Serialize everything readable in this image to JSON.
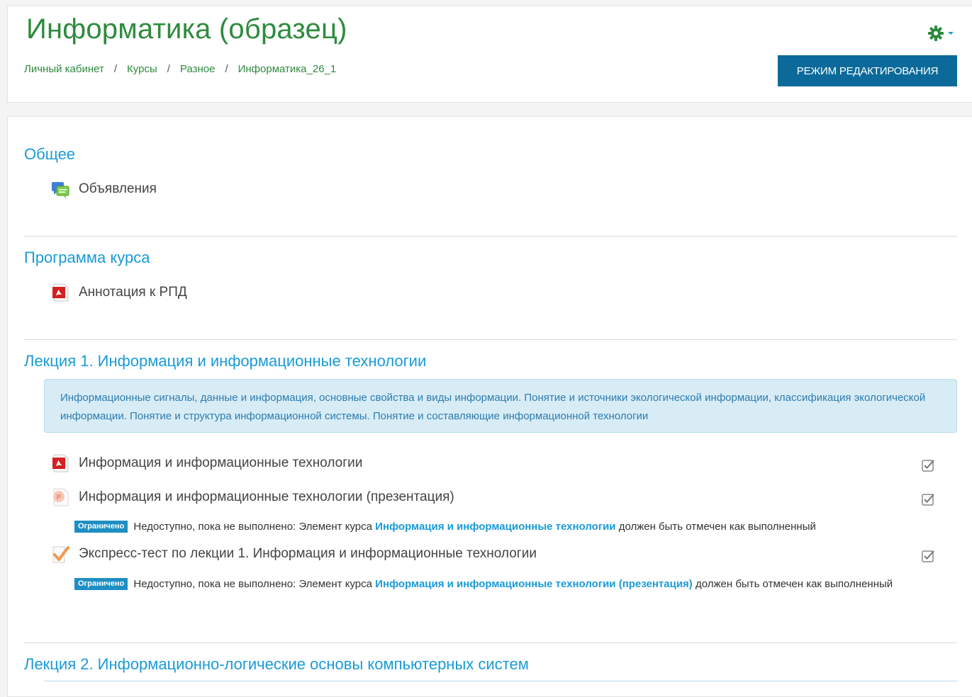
{
  "header": {
    "title": "Информатика (образец)",
    "breadcrumb": [
      "Личный кабинет",
      "Курсы",
      "Разное",
      "Информатика_26_1"
    ],
    "separator": "/",
    "edit_mode_button": "РЕЖИМ РЕДАКТИРОВАНИЯ",
    "settings_icon": "gear-icon",
    "accent_color": "#2e8b3e",
    "button_color": "#0b6a9a"
  },
  "sections": [
    {
      "title": "Общее",
      "activities": [
        {
          "label": "Объявления",
          "icon": "forum-icon"
        }
      ]
    },
    {
      "title": "Программа курса",
      "activities": [
        {
          "label": "Аннотация к РПД",
          "icon": "pdf-icon"
        }
      ]
    },
    {
      "title": "Лекция 1. Информация и информационные технологии",
      "summary": "Информационные сигналы, данные и информация, основные свойства и виды информации. Понятие и источники экологической информации, классификация экологической информации. Понятие и структура информационной системы. Понятие и составляющие информационной технологии",
      "activities": [
        {
          "label": "Информация и информационные технологии",
          "icon": "pdf-icon",
          "completion": "manual-checkbox-icon"
        },
        {
          "label": "Информация и информационные технологии (презентация)",
          "icon": "presentation-icon",
          "completion": "manual-checkbox-icon",
          "restriction": {
            "badge": "Ограничено",
            "prefix": "Недоступно, пока не выполнено: Элемент курса",
            "link": "Информация и информационные технологии",
            "suffix": "должен быть отмечен как выполненный"
          }
        },
        {
          "label": "Экспресс-тест по лекции 1. Информация и информационные технологии",
          "icon": "quiz-icon",
          "completion": "manual-checkbox-icon",
          "restriction": {
            "badge": "Ограничено",
            "prefix": "Недоступно, пока не выполнено: Элемент курса",
            "link": "Информация и информационные технологии (презентация)",
            "suffix": "должен быть отмечен как выполненный"
          }
        }
      ]
    },
    {
      "title": "Лекция 2. Информационно-логические основы компьютерных систем"
    }
  ]
}
